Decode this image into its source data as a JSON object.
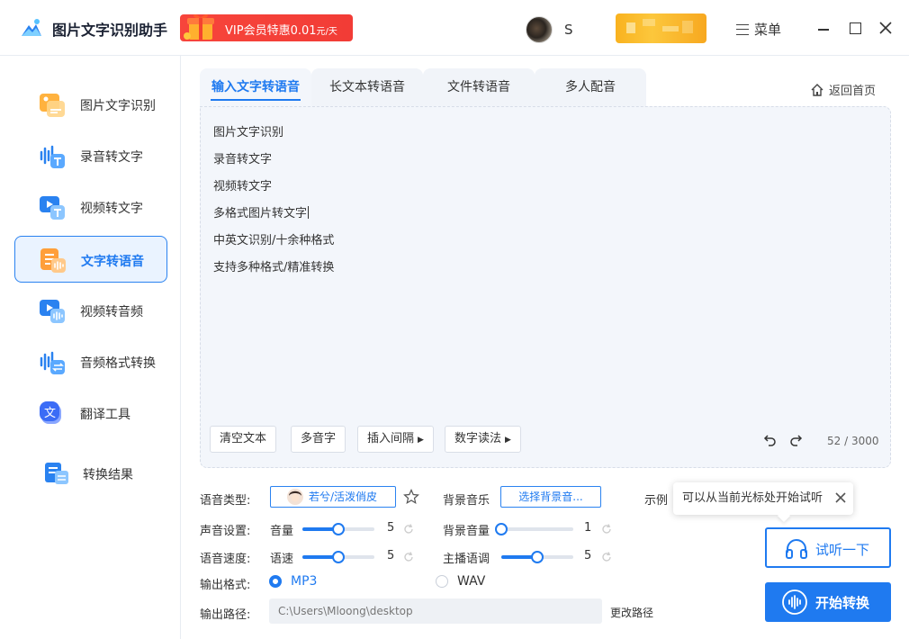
{
  "app": {
    "title": "图片文字识别助手",
    "vip_promo": "VIP会员特惠0.01",
    "vip_unit": "元/天",
    "username": "S",
    "menu_label": "菜单"
  },
  "sidebar": {
    "items": [
      {
        "label": "图片文字识别",
        "icon": "image-text-icon",
        "active": false
      },
      {
        "label": "录音转文字",
        "icon": "audio-to-text-icon",
        "active": false
      },
      {
        "label": "视频转文字",
        "icon": "video-to-text-icon",
        "active": false
      },
      {
        "label": "文字转语音",
        "icon": "text-to-speech-icon",
        "active": true
      },
      {
        "label": "视频转音频",
        "icon": "video-to-audio-icon",
        "active": false
      },
      {
        "label": "音频格式转换",
        "icon": "audio-convert-icon",
        "active": false
      },
      {
        "label": "翻译工具",
        "icon": "translate-icon",
        "active": false
      },
      {
        "label": "转换结果",
        "icon": "results-icon",
        "active": false
      }
    ]
  },
  "tabs": [
    {
      "label": "输入文字转语音",
      "active": true
    },
    {
      "label": "长文本转语音",
      "active": false
    },
    {
      "label": "文件转语音",
      "active": false
    },
    {
      "label": "多人配音",
      "active": false
    }
  ],
  "home_link": "返回首页",
  "editor": {
    "lines": [
      "图片文字识别",
      "录音转文字",
      "视频转文字",
      "多格式图片转文字",
      "中英文识别/十余种格式",
      "支持多种格式/精准转换"
    ],
    "counter": "52 / 3000",
    "buttons": {
      "clear": "清空文本",
      "polyphone": "多音字",
      "insert_pause": "插入间隔",
      "number_reading": "数字读法"
    }
  },
  "settings": {
    "voice_type_label": "语音类型:",
    "voice_name": "若兮/活泼俏皮",
    "bgm_label": "背景音乐",
    "bgm_select": "选择背景音...",
    "sample_label": "示例",
    "sound_label": "声音设置:",
    "volume_label": "音量",
    "volume_value": "5",
    "volume_fraction": 0.5,
    "bg_volume_label": "背景音量",
    "bg_volume_value": "1",
    "bg_volume_fraction": 0.0,
    "speed_label": "语音速度:",
    "speed_sub_label": "语速",
    "speed_value": "5",
    "speed_fraction": 0.5,
    "tone_label": "主播语调",
    "tone_value": "5",
    "tone_fraction": 0.5,
    "format_label": "输出格式:",
    "format_mp3": "MP3",
    "format_wav": "WAV",
    "selected_format": "MP3",
    "path_label": "输出路径:",
    "path_value": "C:\\Users\\Mloong\\desktop",
    "change_path": "更改路径"
  },
  "tooltip": "可以从当前光标处开始试听",
  "actions": {
    "preview": "试听一下",
    "start": "开始转换"
  },
  "colors": {
    "accent": "#1f7af0",
    "vip_red": "#f23c36",
    "gold": "#fcc73c"
  }
}
